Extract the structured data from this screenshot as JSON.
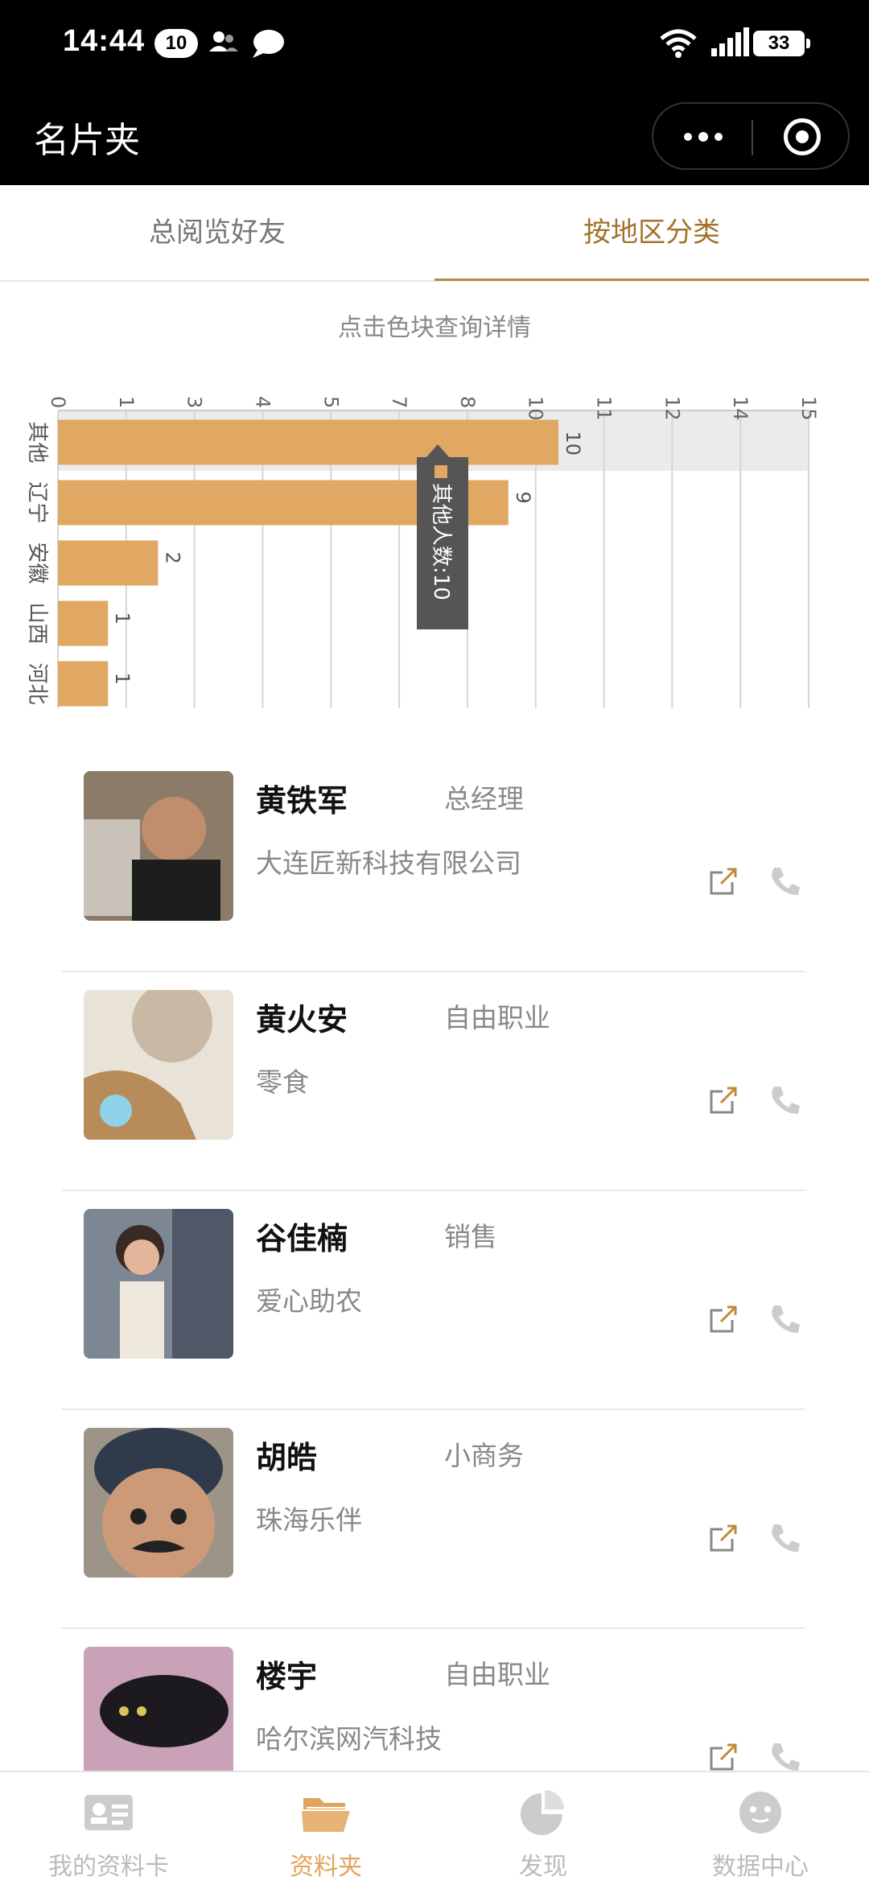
{
  "status_bar": {
    "time": "14:44",
    "notification_count": "10",
    "battery": "33"
  },
  "header": {
    "title": "名片夹"
  },
  "tabs": [
    {
      "label": "总阅览好友",
      "active": false
    },
    {
      "label": "按地区分类",
      "active": true
    }
  ],
  "chart_hint": "点击色块查询详情",
  "chart_data": {
    "type": "bar",
    "orientation": "horizontal",
    "categories": [
      "其他",
      "辽宁",
      "安徽",
      "山西",
      "河北"
    ],
    "values": [
      10,
      9,
      2,
      1,
      1
    ],
    "axis_ticks": [
      "0",
      "1",
      "3",
      "4",
      "5",
      "7",
      "8",
      "10",
      "11",
      "12",
      "14",
      "15"
    ],
    "xlim": [
      0,
      15
    ],
    "bar_color": "#e0a862",
    "highlighted_category": "其他",
    "tooltip": "其他人数:10",
    "grid": true
  },
  "contacts": [
    {
      "name": "黄铁军",
      "title": "总经理",
      "company": "大连匠新科技有限公司"
    },
    {
      "name": "黄火安",
      "title": "自由职业",
      "company": "零食"
    },
    {
      "name": "谷佳楠",
      "title": "销售",
      "company": "爱心助农"
    },
    {
      "name": "胡皓",
      "title": "小商务",
      "company": "珠海乐伴"
    },
    {
      "name": "楼宇",
      "title": "自由职业",
      "company": "哈尔滨网汽科技"
    }
  ],
  "tabbar": [
    {
      "label": "我的资料卡",
      "icon": "card-icon",
      "active": false
    },
    {
      "label": "资料夹",
      "icon": "folder-icon",
      "active": true
    },
    {
      "label": "发现",
      "icon": "pie-chart-icon",
      "active": false
    },
    {
      "label": "数据中心",
      "icon": "smiley-icon",
      "active": false
    }
  ],
  "colors": {
    "accent": "#a2722c",
    "bar": "#e0a862",
    "tab_active": "#e2a45c"
  }
}
